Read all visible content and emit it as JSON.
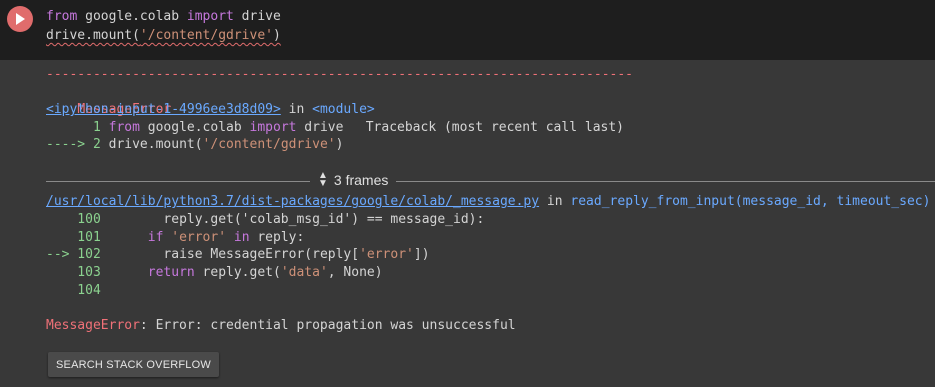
{
  "code": {
    "line1": {
      "kw_from": "from",
      "module": " google.colab ",
      "kw_import": "import",
      "name": " drive"
    },
    "line2": {
      "prefix": "drive.mount(",
      "arg": "'/content/gdrive'",
      "suffix": ")"
    }
  },
  "output": {
    "dash_line": "---------------------------------------------------------------------------",
    "error_name": "MessageError",
    "traceback_header": "Traceback (most recent call last)",
    "input_link": "<ipython-input-1-4996ee3d8d09>",
    "in_text": " in ",
    "module_text": "<module>",
    "frame1": [
      {
        "lineno": "      1",
        "code_a": " from",
        "code_b": " google.colab ",
        "code_c": "import",
        "code_d": " drive"
      },
      {
        "arrow": "----> 2",
        "code_a": " drive.mount(",
        "code_b": "'/content/gdrive'",
        "code_c": ")"
      }
    ],
    "frames_label": "3 frames",
    "file_link": "/usr/local/lib/python3.7/dist-packages/google/colab/_message.py",
    "func_text": "read_reply_from_input(message_id, timeout_sec)",
    "frame2": [
      {
        "lineno": "    100",
        "code": "        reply.get('colab_msg_id') == message_id):"
      },
      {
        "lineno": "    101",
        "code_kw": "      if",
        "code_str": " 'error'",
        "code_kw2": " in",
        "code_rest": " reply:"
      },
      {
        "arrow": "--> 102",
        "code": "        raise MessageError(reply[",
        "code_str": "'error'",
        "code_end": "])"
      },
      {
        "lineno": "    103",
        "code_kw": "      return",
        "code_a": " reply.get(",
        "code_str": "'data'",
        "code_b": ", None)"
      },
      {
        "lineno": "    104",
        "code": ""
      }
    ],
    "final_error_name": "MessageError",
    "final_error_msg": ": Error: credential propagation was unsuccessful"
  },
  "search_button": "SEARCH STACK OVERFLOW",
  "colors": {
    "run_button": "#e06c6c",
    "error": "#f07178",
    "link": "#6aa9ff",
    "lineno": "#8bd28f"
  }
}
